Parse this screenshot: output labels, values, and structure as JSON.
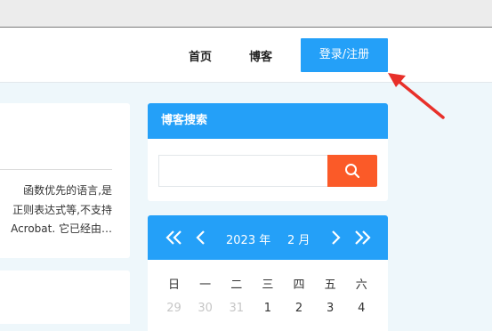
{
  "nav": {
    "home": "首页",
    "blog": "博客",
    "login": "登录/注册"
  },
  "article": {
    "line1": "函数优先的语言,是",
    "line2": "正则表达式等,不支持",
    "line3": "Acrobat. 它已经由…"
  },
  "search": {
    "title": "博客搜索",
    "value": "",
    "placeholder": ""
  },
  "calendar": {
    "year": "2023 年",
    "month": "2 月",
    "weekdays": [
      "日",
      "一",
      "二",
      "三",
      "四",
      "五",
      "六"
    ],
    "days": [
      {
        "label": "29",
        "muted": true
      },
      {
        "label": "30",
        "muted": true
      },
      {
        "label": "31",
        "muted": true
      },
      {
        "label": "1",
        "muted": false
      },
      {
        "label": "2",
        "muted": false
      },
      {
        "label": "3",
        "muted": false
      },
      {
        "label": "4",
        "muted": false
      }
    ]
  },
  "colors": {
    "primary": "#24a0f8",
    "search_button": "#fb5a28",
    "arrow": "#e8302a",
    "background": "#eef7fb"
  },
  "icons": {
    "search": "search-icon",
    "prev_year": "double-chevron-left-icon",
    "prev_month": "chevron-left-icon",
    "next_month": "chevron-right-icon",
    "next_year": "double-chevron-right-icon",
    "annotation": "red-arrow-icon"
  }
}
